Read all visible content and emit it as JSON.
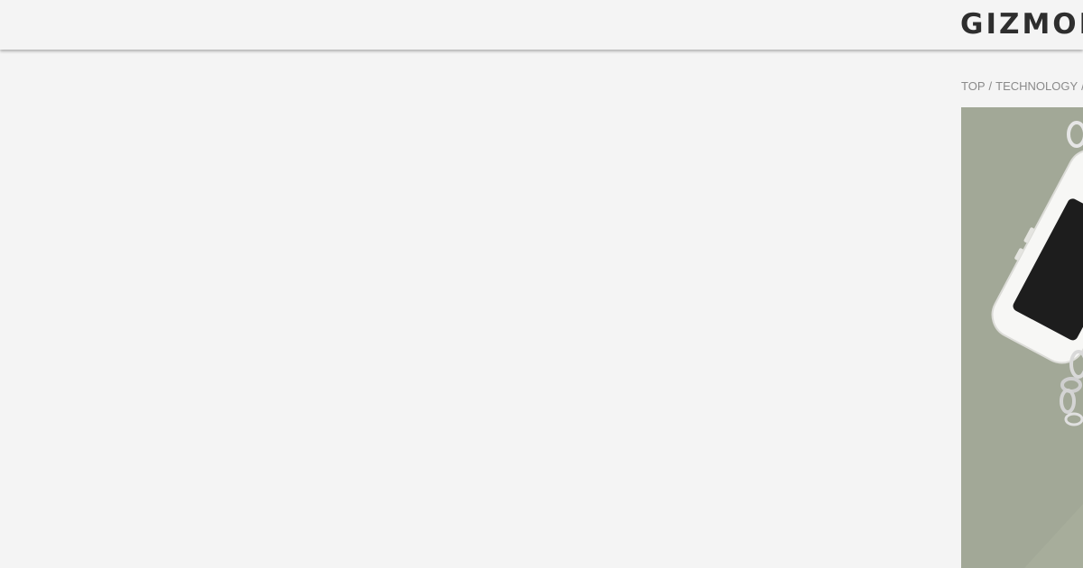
{
  "header": {
    "logo_text": "GIZMODO"
  },
  "breadcrumb": {
    "items": [
      "TOP",
      "TECHNOLOGY",
      "G"
    ],
    "separator": "/"
  },
  "hero": {
    "background_color": "#a2a897",
    "subject_icon": "phone-with-chain-image"
  }
}
